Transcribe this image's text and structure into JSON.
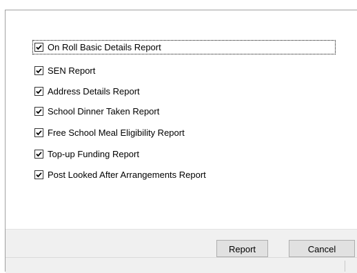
{
  "options": [
    {
      "label": "On Roll Basic Details Report",
      "checked": true,
      "focused": true
    },
    {
      "label": "SEN Report",
      "checked": true,
      "focused": false
    },
    {
      "label": "Address Details Report",
      "checked": true,
      "focused": false
    },
    {
      "label": "School Dinner Taken Report",
      "checked": true,
      "focused": false
    },
    {
      "label": "Free School Meal Eligibility Report",
      "checked": true,
      "focused": false
    },
    {
      "label": "Top-up Funding Report",
      "checked": true,
      "focused": false
    },
    {
      "label": "Post Looked After Arrangements Report",
      "checked": true,
      "focused": false
    }
  ],
  "buttons": {
    "report_label": "Report",
    "cancel_label": "Cancel"
  },
  "colors": {
    "footer_bg": "#f0f0f0",
    "button_bg": "#e1e1e1",
    "button_border": "#adadad"
  }
}
